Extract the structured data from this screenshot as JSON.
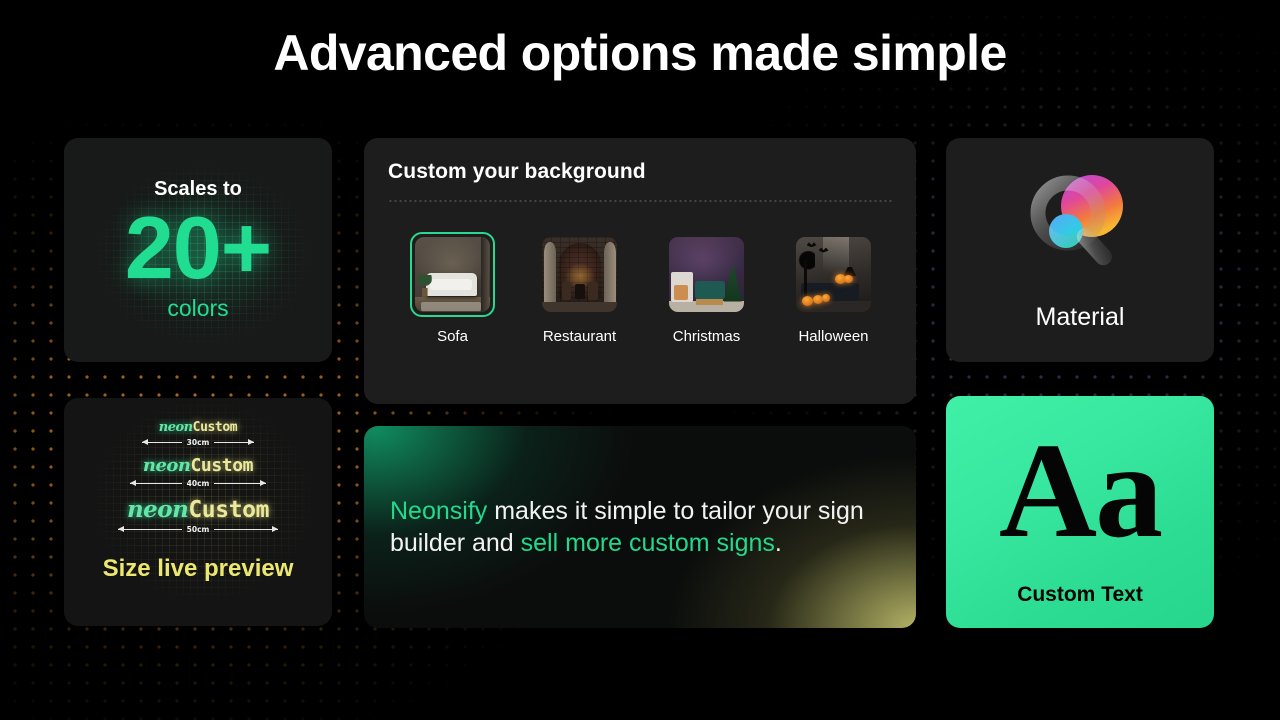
{
  "page": {
    "title": "Advanced options made simple",
    "accent_green": "#22d98c",
    "accent_yellow": "#ece86f",
    "background": "#000000",
    "card_background": "#1d1d1d",
    "dot_grid_amber": "#b8701a",
    "dot_grid_blue": "#2c3f55"
  },
  "scales_card": {
    "label": "Scales to",
    "number": "20+",
    "subtitle": "colors"
  },
  "size_card": {
    "caption": "Size live preview",
    "previews": [
      {
        "word_a": "neon",
        "word_b": "Custom",
        "size": "30cm"
      },
      {
        "word_a": "neon",
        "word_b": "Custom",
        "size": "40cm"
      },
      {
        "word_a": "neon",
        "word_b": "Custom",
        "size": "50cm"
      }
    ]
  },
  "background_card": {
    "title": "Custom your background",
    "thumbnails": [
      {
        "label": "Sofa",
        "selected": true
      },
      {
        "label": "Restaurant",
        "selected": false
      },
      {
        "label": "Christmas",
        "selected": false
      },
      {
        "label": "Halloween",
        "selected": false
      }
    ]
  },
  "tagline_card": {
    "segments": [
      {
        "text": "Neonsify",
        "highlight": true
      },
      {
        "text": " makes it simple to tailor your sign builder and ",
        "highlight": false
      },
      {
        "text": "sell more custom signs",
        "highlight": true
      },
      {
        "text": ".",
        "highlight": false
      }
    ]
  },
  "material_card": {
    "label": "Material",
    "icon": "magnifier-gradient-icon"
  },
  "text_card": {
    "glyph": "Aa",
    "label": "Custom Text"
  }
}
